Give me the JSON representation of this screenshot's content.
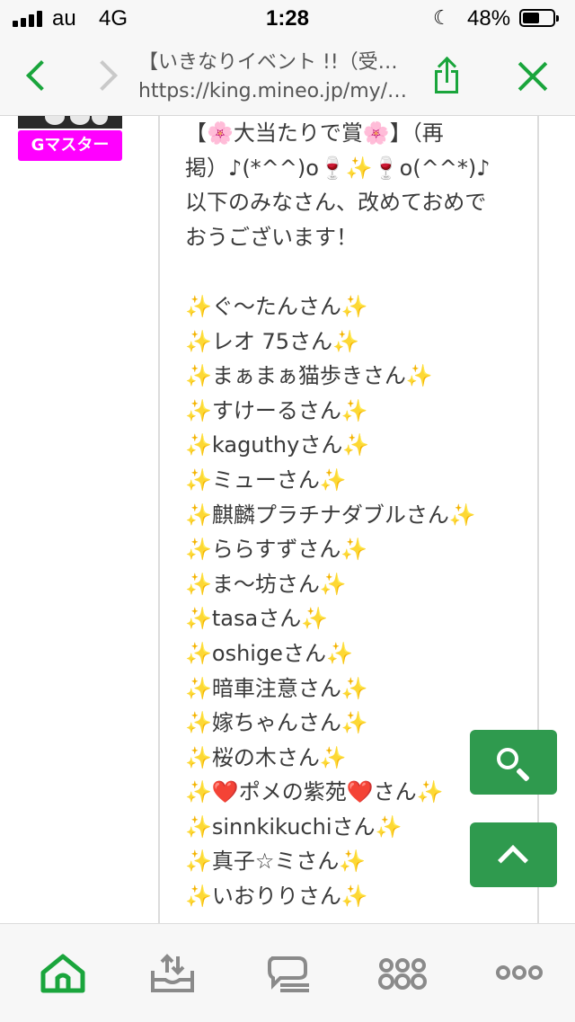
{
  "status_bar": {
    "carrier": "au",
    "network": "4G",
    "time": "1:28",
    "battery_percent": "48%",
    "battery_level": 0.48,
    "signal_bars": 4
  },
  "browser": {
    "title": "【いきなりイベント !!（受…",
    "url": "https://king.mineo.jp/my/…",
    "accent_color": "#1aa53c"
  },
  "author": {
    "badge": "Gマスター",
    "badge_color": "#ff00ff"
  },
  "post": {
    "intro_lines": [
      "【🌸大当たりで賞🌸】（再",
      "掲）♪(*^^)o🍷✨🍷o(^^*)♪",
      "以下のみなさん、改めておめで",
      "おうございます！"
    ],
    "winners": [
      "✨ぐ〜たんさん✨",
      "✨レオ 75さん✨",
      "✨まぁまぁ猫歩きさん✨",
      "✨すけーるさん✨",
      "✨kaguthyさん✨",
      "✨ミューさん✨",
      "✨麒麟プラチナダブルさん✨",
      "✨ららすずさん✨",
      "✨ま〜坊さん✨",
      "✨tasaさん✨",
      "✨oshigeさん✨",
      "✨暗車注意さん✨",
      "✨嫁ちゃんさん✨",
      "✨桜の木さん✨",
      "✨❤️ポメの紫苑❤️さん✨",
      "✨sinnkikuchiさん✨",
      "✨真子☆ミさん✨",
      "✨いおりりさん✨"
    ]
  },
  "floating_buttons": {
    "color": "#2f9a4e",
    "search_icon": "search-icon",
    "up_icon": "chevron-up-icon"
  },
  "tab_bar": {
    "tabs": [
      {
        "icon": "home-icon",
        "active": true
      },
      {
        "icon": "tray-upload-icon",
        "active": false
      },
      {
        "icon": "chat-bubble-icon",
        "active": false
      },
      {
        "icon": "community-icon",
        "active": false
      },
      {
        "icon": "more-icon",
        "active": false
      }
    ]
  }
}
